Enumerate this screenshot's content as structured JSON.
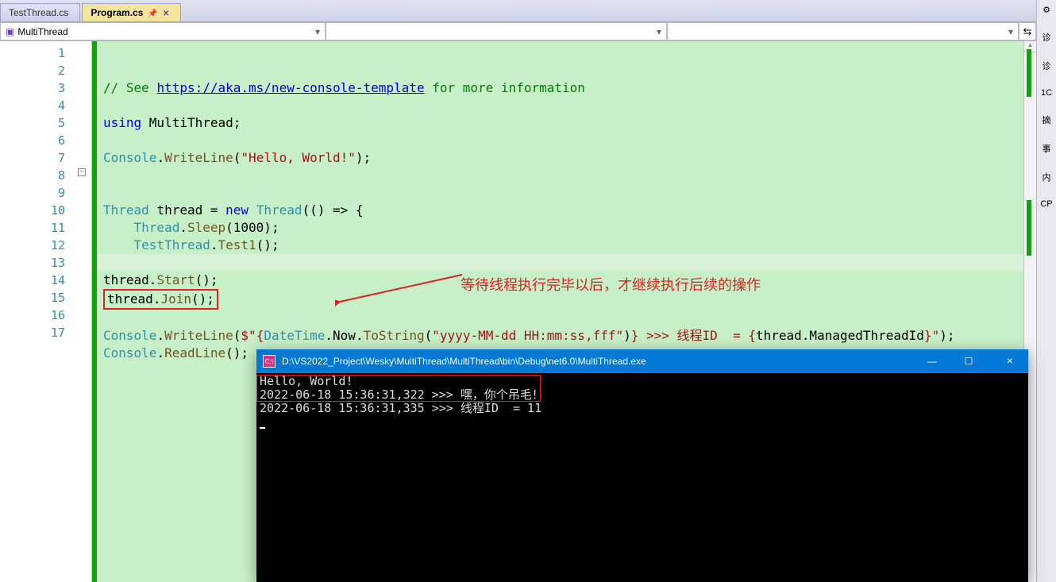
{
  "tabs": [
    {
      "label": "TestThread.cs",
      "active": false
    },
    {
      "label": "Program.cs",
      "active": true
    }
  ],
  "nav": {
    "dd1": "MultiThread",
    "dd2": "",
    "dd3": ""
  },
  "code": {
    "linecount": 17,
    "comment": "// See ",
    "link": "https://aka.ms/new-console-template",
    "comment_tail": " for more information",
    "using": "using ",
    "ns": "MultiThread",
    "console": "Console",
    "writeline": "WriteLine",
    "hello": "\"Hello, World!\"",
    "thread_t": "Thread",
    "thread_v": "thread",
    "new": "new",
    "lambda": "(() => {",
    "sleep": "Sleep",
    "sleep_arg": "(1000)",
    "testthread": "TestThread",
    "test1": "Test1",
    "start": "Start",
    "join": "Join",
    "dt": "DateTime",
    "now": "Now",
    "tostring": "ToString",
    "fmt": "\"yyyy-MM-dd HH:mm:ss,fff\"",
    "tail1": "} >>> 线程ID  = {",
    "mti": "ManagedThreadId",
    "readline": "ReadLine",
    "dollar": "$\"{",
    "close_interp": "}\""
  },
  "annotation": "等待线程执行完毕以后，才继续执行后续的操作",
  "console_win": {
    "title": "D:\\VS2022_Project\\Wesky\\MultiThread\\MultiThread\\bin\\Debug\\net6.0\\MultiThread.exe",
    "line1": "Hello, World!",
    "line2": "2022-06-18 15:36:31,322 >>> 嘿，你个吊毛！",
    "line3": "2022-06-18 15:36:31,335 >>> 线程ID  = 11"
  },
  "right": {
    "a": "诊",
    "b": "诊",
    "c": "1C",
    "d": "摘",
    "e": "事",
    "f": "内",
    "g": "CP"
  }
}
